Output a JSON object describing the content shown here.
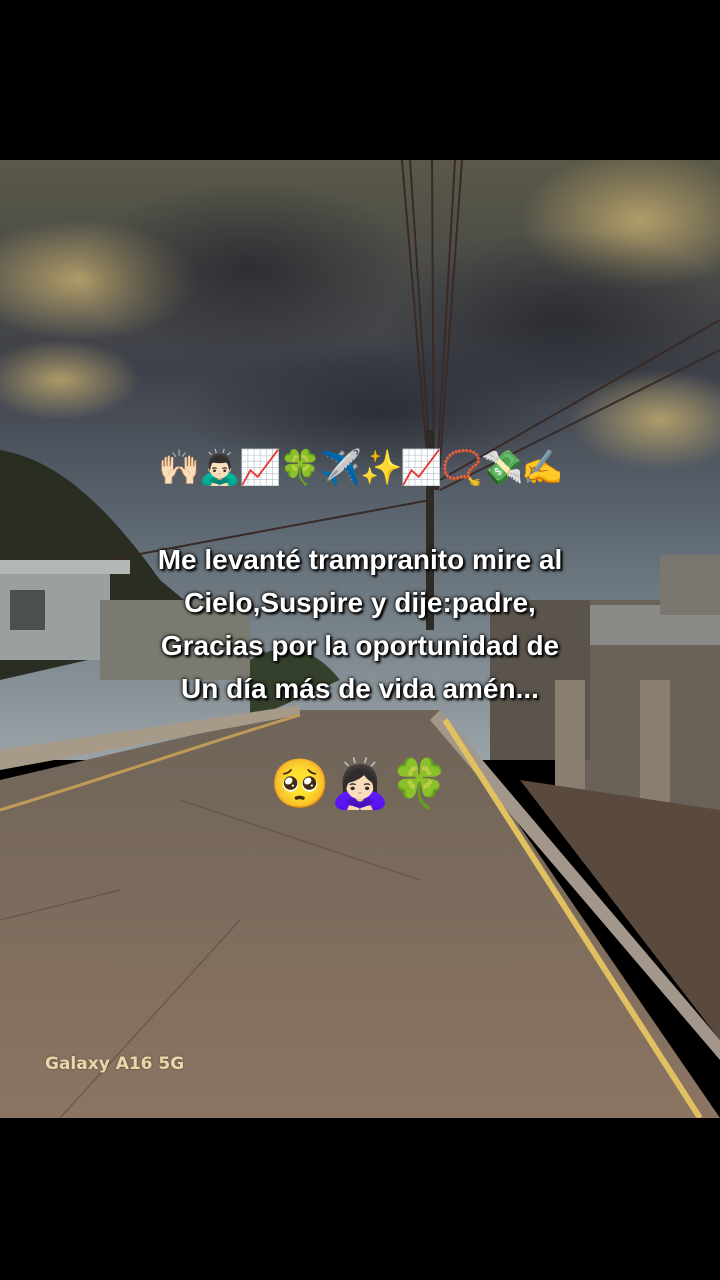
{
  "post": {
    "emoji_top": "🙌🏻🙇🏻‍♂️📈🍀✈️✨📈📿💸✍️",
    "caption_lines": [
      "Me levanté trampranito mire al",
      "Cielo,Suspire y dije:padre,",
      "Gracias por la oportunidad de",
      "Un día más de vida amén..."
    ],
    "emoji_bottom": "🥺🙇🏻‍♀️🍀"
  },
  "watermark": {
    "text": "Galaxy A16 5G"
  },
  "colors": {
    "sky_dark": "#3a3c44",
    "sky_light": "#8a8468",
    "road": "#7d6a58",
    "watermark": "#e8d8a8"
  }
}
